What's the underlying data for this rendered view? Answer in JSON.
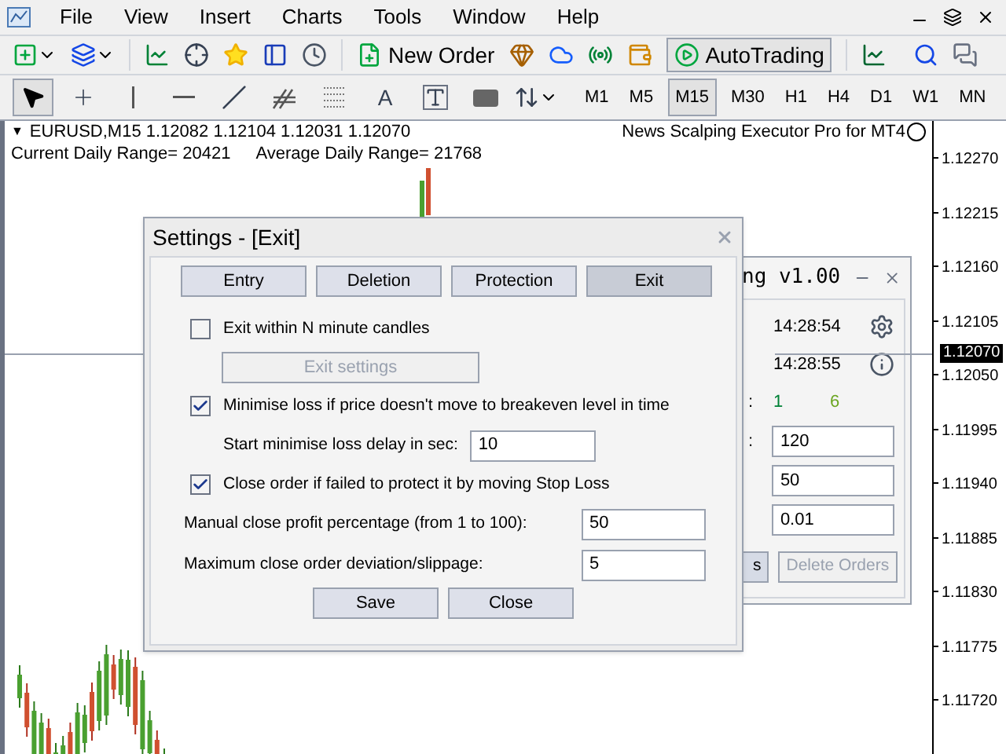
{
  "menu": {
    "items": [
      "File",
      "View",
      "Insert",
      "Charts",
      "Tools",
      "Window",
      "Help"
    ]
  },
  "toolbar": {
    "new_order": "New Order",
    "autotrading": "AutoTrading"
  },
  "drawing_tools": [
    {
      "kind": "cursor",
      "selected": true
    },
    {
      "kind": "crosshair",
      "selected": false
    },
    {
      "kind": "vline",
      "selected": false
    },
    {
      "kind": "hline",
      "selected": false
    },
    {
      "kind": "trend",
      "selected": false
    },
    {
      "kind": "channel",
      "selected": false
    },
    {
      "kind": "fibo",
      "selected": false
    },
    {
      "kind": "text",
      "label": "A",
      "selected": false
    },
    {
      "kind": "label",
      "selected": false
    },
    {
      "kind": "rect",
      "selected": false
    },
    {
      "kind": "arrows",
      "selected": false
    }
  ],
  "timeframes": [
    {
      "label": "M1",
      "selected": false
    },
    {
      "label": "M5",
      "selected": false
    },
    {
      "label": "M15",
      "selected": true
    },
    {
      "label": "M30",
      "selected": false
    },
    {
      "label": "H1",
      "selected": false
    },
    {
      "label": "H4",
      "selected": false
    },
    {
      "label": "D1",
      "selected": false
    },
    {
      "label": "W1",
      "selected": false
    },
    {
      "label": "MN",
      "selected": false
    }
  ],
  "chart": {
    "toggle": "▼",
    "header": "EURUSD,M15  1.12082 1.12104 1.12031 1.12070",
    "current_range": "Current Daily Range= 20421",
    "average_range": "Average Daily Range= 21768",
    "expert_name": "News Scalping Executor Pro for MT4",
    "price_axis": [
      "1.12270",
      "1.12215",
      "1.12160",
      "1.12105",
      "1.12050",
      "1.11995",
      "1.11940",
      "1.11885",
      "1.11830",
      "1.11775",
      "1.11720"
    ],
    "current_price": "1.12070"
  },
  "back_panel": {
    "title": "ng v1.00",
    "times": [
      "14:28:54",
      "14:28:55"
    ],
    "colons": [
      ":",
      ":"
    ],
    "counts": [
      "1",
      "6"
    ],
    "fields": [
      "120",
      "50",
      "0.01"
    ],
    "buttons": [
      {
        "label": "s",
        "disabled": false
      },
      {
        "label": "Delete Orders",
        "disabled": true
      }
    ]
  },
  "dialog": {
    "title": "Settings - [Exit]",
    "tabs": [
      {
        "label": "Entry",
        "selected": false
      },
      {
        "label": "Deletion",
        "selected": false
      },
      {
        "label": "Protection",
        "selected": false
      },
      {
        "label": "Exit",
        "selected": true
      }
    ],
    "options": [
      {
        "kind": "checkbox",
        "label": "Exit within N minute candles",
        "checked": false
      },
      {
        "kind": "button",
        "label": "Exit settings",
        "disabled": true
      },
      {
        "kind": "checkbox",
        "label": "Minimise loss if price doesn't move to breakeven level in time",
        "checked": true
      },
      {
        "kind": "subfield",
        "label": "Start minimise loss delay in sec:",
        "value": "10"
      },
      {
        "kind": "checkbox",
        "label": "Close order if failed to protect it by moving Stop Loss",
        "checked": true
      },
      {
        "kind": "field",
        "label": "Manual close profit percentage (from 1 to 100):",
        "value": "50"
      },
      {
        "kind": "field",
        "label": "Maximum close order deviation/slippage:",
        "value": "5"
      }
    ],
    "buttons": [
      "Save",
      "Close"
    ]
  }
}
